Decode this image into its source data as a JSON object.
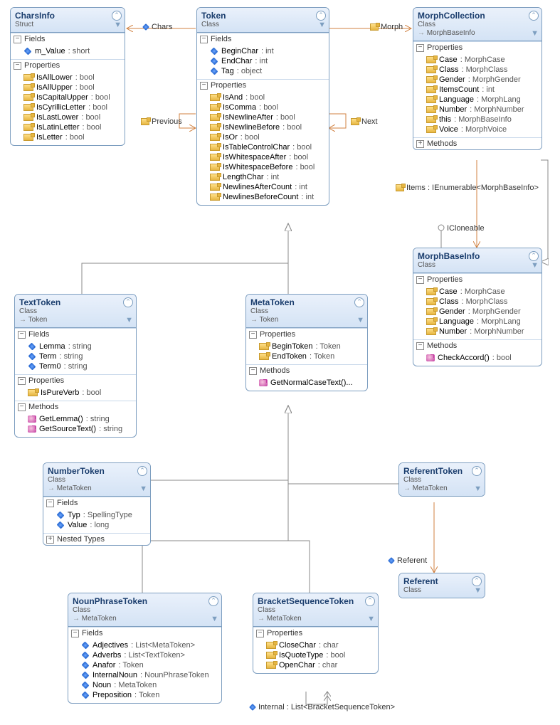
{
  "diagram": {
    "type": "uml-class-diagram",
    "classes": {
      "CharsInfo": {
        "name": "CharsInfo",
        "kind": "Struct",
        "base": null,
        "sections": [
          {
            "title": "Fields",
            "kind": "fields",
            "members": [
              {
                "name": "m_Value",
                "type": "short"
              }
            ]
          },
          {
            "title": "Properties",
            "kind": "props",
            "members": [
              {
                "name": "IsAllLower",
                "type": "bool"
              },
              {
                "name": "IsAllUpper",
                "type": "bool"
              },
              {
                "name": "IsCapitalUpper",
                "type": "bool"
              },
              {
                "name": "IsCyrillicLetter",
                "type": "bool"
              },
              {
                "name": "IsLastLower",
                "type": "bool"
              },
              {
                "name": "IsLatinLetter",
                "type": "bool"
              },
              {
                "name": "IsLetter",
                "type": "bool"
              }
            ]
          }
        ]
      },
      "Token": {
        "name": "Token",
        "kind": "Class",
        "base": null,
        "sections": [
          {
            "title": "Fields",
            "kind": "fields",
            "members": [
              {
                "name": "BeginChar",
                "type": "int"
              },
              {
                "name": "EndChar",
                "type": "int"
              },
              {
                "name": "Tag",
                "type": "object"
              }
            ]
          },
          {
            "title": "Properties",
            "kind": "props",
            "members": [
              {
                "name": "IsAnd",
                "type": "bool"
              },
              {
                "name": "IsComma",
                "type": "bool"
              },
              {
                "name": "IsNewlineAfter",
                "type": "bool"
              },
              {
                "name": "IsNewlineBefore",
                "type": "bool"
              },
              {
                "name": "IsOr",
                "type": "bool"
              },
              {
                "name": "IsTableControlChar",
                "type": "bool"
              },
              {
                "name": "IsWhitespaceAfter",
                "type": "bool"
              },
              {
                "name": "IsWhitespaceBefore",
                "type": "bool"
              },
              {
                "name": "LengthChar",
                "type": "int"
              },
              {
                "name": "NewlinesAfterCount",
                "type": "int"
              },
              {
                "name": "NewlinesBeforeCount",
                "type": "int"
              }
            ]
          }
        ]
      },
      "MorphCollection": {
        "name": "MorphCollection",
        "kind": "Class",
        "base": "MorphBaseInfo",
        "sections": [
          {
            "title": "Properties",
            "kind": "props",
            "members": [
              {
                "name": "Case",
                "type": "MorphCase"
              },
              {
                "name": "Class",
                "type": "MorphClass"
              },
              {
                "name": "Gender",
                "type": "MorphGender"
              },
              {
                "name": "ItemsCount",
                "type": "int"
              },
              {
                "name": "Language",
                "type": "MorphLang"
              },
              {
                "name": "Number",
                "type": "MorphNumber"
              },
              {
                "name": "this",
                "type": "MorphBaseInfo"
              },
              {
                "name": "Voice",
                "type": "MorphVoice"
              }
            ]
          },
          {
            "title": "Methods",
            "kind": "methods",
            "collapsed": true,
            "members": []
          }
        ]
      },
      "MorphBaseInfo": {
        "name": "MorphBaseInfo",
        "kind": "Class",
        "base": null,
        "sections": [
          {
            "title": "Properties",
            "kind": "props",
            "members": [
              {
                "name": "Case",
                "type": "MorphCase"
              },
              {
                "name": "Class",
                "type": "MorphClass"
              },
              {
                "name": "Gender",
                "type": "MorphGender"
              },
              {
                "name": "Language",
                "type": "MorphLang"
              },
              {
                "name": "Number",
                "type": "MorphNumber"
              }
            ]
          },
          {
            "title": "Methods",
            "kind": "methods",
            "members": [
              {
                "name": "CheckAccord()",
                "type": "bool"
              }
            ]
          }
        ]
      },
      "TextToken": {
        "name": "TextToken",
        "kind": "Class",
        "base": "Token",
        "sections": [
          {
            "title": "Fields",
            "kind": "fields",
            "members": [
              {
                "name": "Lemma",
                "type": "string"
              },
              {
                "name": "Term",
                "type": "string"
              },
              {
                "name": "Term0",
                "type": "string"
              }
            ]
          },
          {
            "title": "Properties",
            "kind": "props",
            "members": [
              {
                "name": "IsPureVerb",
                "type": "bool"
              }
            ]
          },
          {
            "title": "Methods",
            "kind": "methods",
            "members": [
              {
                "name": "GetLemma()",
                "type": "string"
              },
              {
                "name": "GetSourceText()",
                "type": "string"
              }
            ]
          }
        ]
      },
      "MetaToken": {
        "name": "MetaToken",
        "kind": "Class",
        "base": "Token",
        "sections": [
          {
            "title": "Properties",
            "kind": "props",
            "members": [
              {
                "name": "BeginToken",
                "type": "Token"
              },
              {
                "name": "EndToken",
                "type": "Token"
              }
            ]
          },
          {
            "title": "Methods",
            "kind": "methods",
            "members": [
              {
                "name": "GetNormalCaseText()...",
                "type": null
              }
            ]
          }
        ]
      },
      "NumberToken": {
        "name": "NumberToken",
        "kind": "Class",
        "base": "MetaToken",
        "sections": [
          {
            "title": "Fields",
            "kind": "fields",
            "members": [
              {
                "name": "Typ",
                "type": "SpellingType"
              },
              {
                "name": "Value",
                "type": "long"
              }
            ]
          },
          {
            "title": "Nested Types",
            "kind": "nested",
            "collapsed": true,
            "members": []
          }
        ]
      },
      "ReferentToken": {
        "name": "ReferentToken",
        "kind": "Class",
        "base": "MetaToken",
        "sections": []
      },
      "Referent": {
        "name": "Referent",
        "kind": "Class",
        "base": null,
        "sections": []
      },
      "NounPhraseToken": {
        "name": "NounPhraseToken",
        "kind": "Class",
        "base": "MetaToken",
        "sections": [
          {
            "title": "Fields",
            "kind": "fields",
            "members": [
              {
                "name": "Adjectives",
                "type": "List<MetaToken>"
              },
              {
                "name": "Adverbs",
                "type": "List<TextToken>"
              },
              {
                "name": "Anafor",
                "type": "Token"
              },
              {
                "name": "InternalNoun",
                "type": "NounPhraseToken"
              },
              {
                "name": "Noun",
                "type": "MetaToken"
              },
              {
                "name": "Preposition",
                "type": "Token"
              }
            ]
          }
        ]
      },
      "BracketSequenceToken": {
        "name": "BracketSequenceToken",
        "kind": "Class",
        "base": "MetaToken",
        "sections": [
          {
            "title": "Properties",
            "kind": "props",
            "members": [
              {
                "name": "CloseChar",
                "type": "char"
              },
              {
                "name": "IsQuoteType",
                "type": "bool"
              },
              {
                "name": "OpenChar",
                "type": "char"
              }
            ]
          }
        ]
      }
    },
    "labels": {
      "Chars": "Chars",
      "Previous": "Previous",
      "Next": "Next",
      "Morph": "Morph",
      "Items": "Items : IEnumerable<MorphBaseInfo>",
      "ICloneable": "ICloneable",
      "Referent": "Referent",
      "Internal": "Internal : List<BracketSequenceToken>"
    }
  }
}
